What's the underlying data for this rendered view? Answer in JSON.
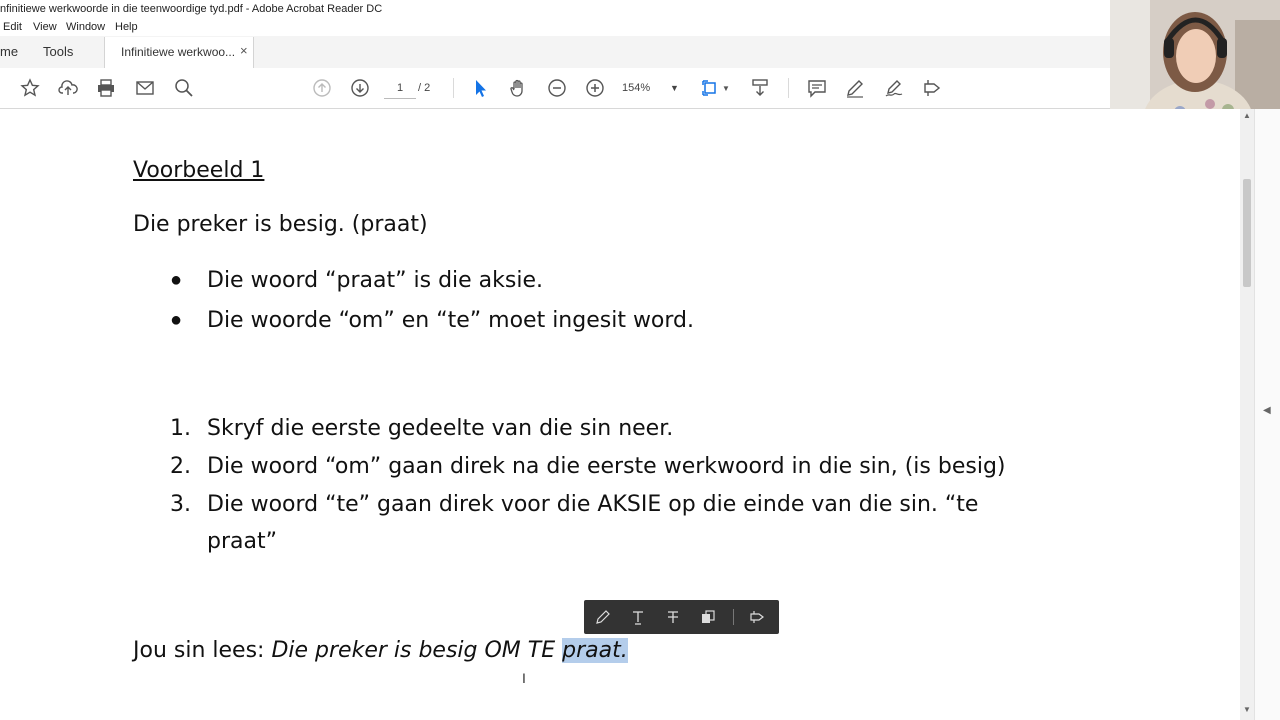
{
  "window": {
    "title": "nfinitiewe werkwoorde in die teenwoordige tyd.pdf - Adobe Acrobat Reader DC"
  },
  "menu": [
    "Edit",
    "View",
    "Window",
    "Help"
  ],
  "tabs": {
    "home": "me",
    "tools": "Tools",
    "doc": "Infinitiewe werkwoo...",
    "close": "×"
  },
  "toolbar": {
    "page_current": "1",
    "page_total": "/ 2",
    "zoom": "154%"
  },
  "document": {
    "heading": "Voorbeeld 1",
    "sentence": "Die preker is besig. (praat)",
    "bullets": [
      "Die woord “praat” is die aksie.",
      "Die woorde “om” en “te” moet ingesit word."
    ],
    "steps": [
      {
        "num": "1.",
        "text": "Skryf die eerste gedeelte van die sin neer."
      },
      {
        "num": "2.",
        "text": "Die woord “om” gaan direk na die eerste werkwoord in die sin, (is besig)"
      },
      {
        "num": "3.",
        "text": "Die woord “te” gaan direk voor die AKSIE op die einde van die sin. “te",
        "cont": "praat”"
      }
    ],
    "answer_label": "Jou sin lees: ",
    "answer_italic": "Die preker is besig OM TE ",
    "answer_highlight": "praat."
  },
  "colors": {
    "highlight": "#b4cdeb",
    "toolbar_blue": "#1473e6",
    "popup_bg": "#333333"
  },
  "icons": [
    "star-icon",
    "cloud-upload-icon",
    "print-icon",
    "mail-icon",
    "search-icon",
    "arrow-up-circle-icon",
    "arrow-down-circle-icon",
    "select-pointer-icon",
    "hand-icon",
    "zoom-out-icon",
    "zoom-in-icon",
    "fit-page-icon",
    "scroll-mode-icon",
    "comment-icon",
    "pen-icon",
    "sign-icon",
    "share-icon"
  ]
}
